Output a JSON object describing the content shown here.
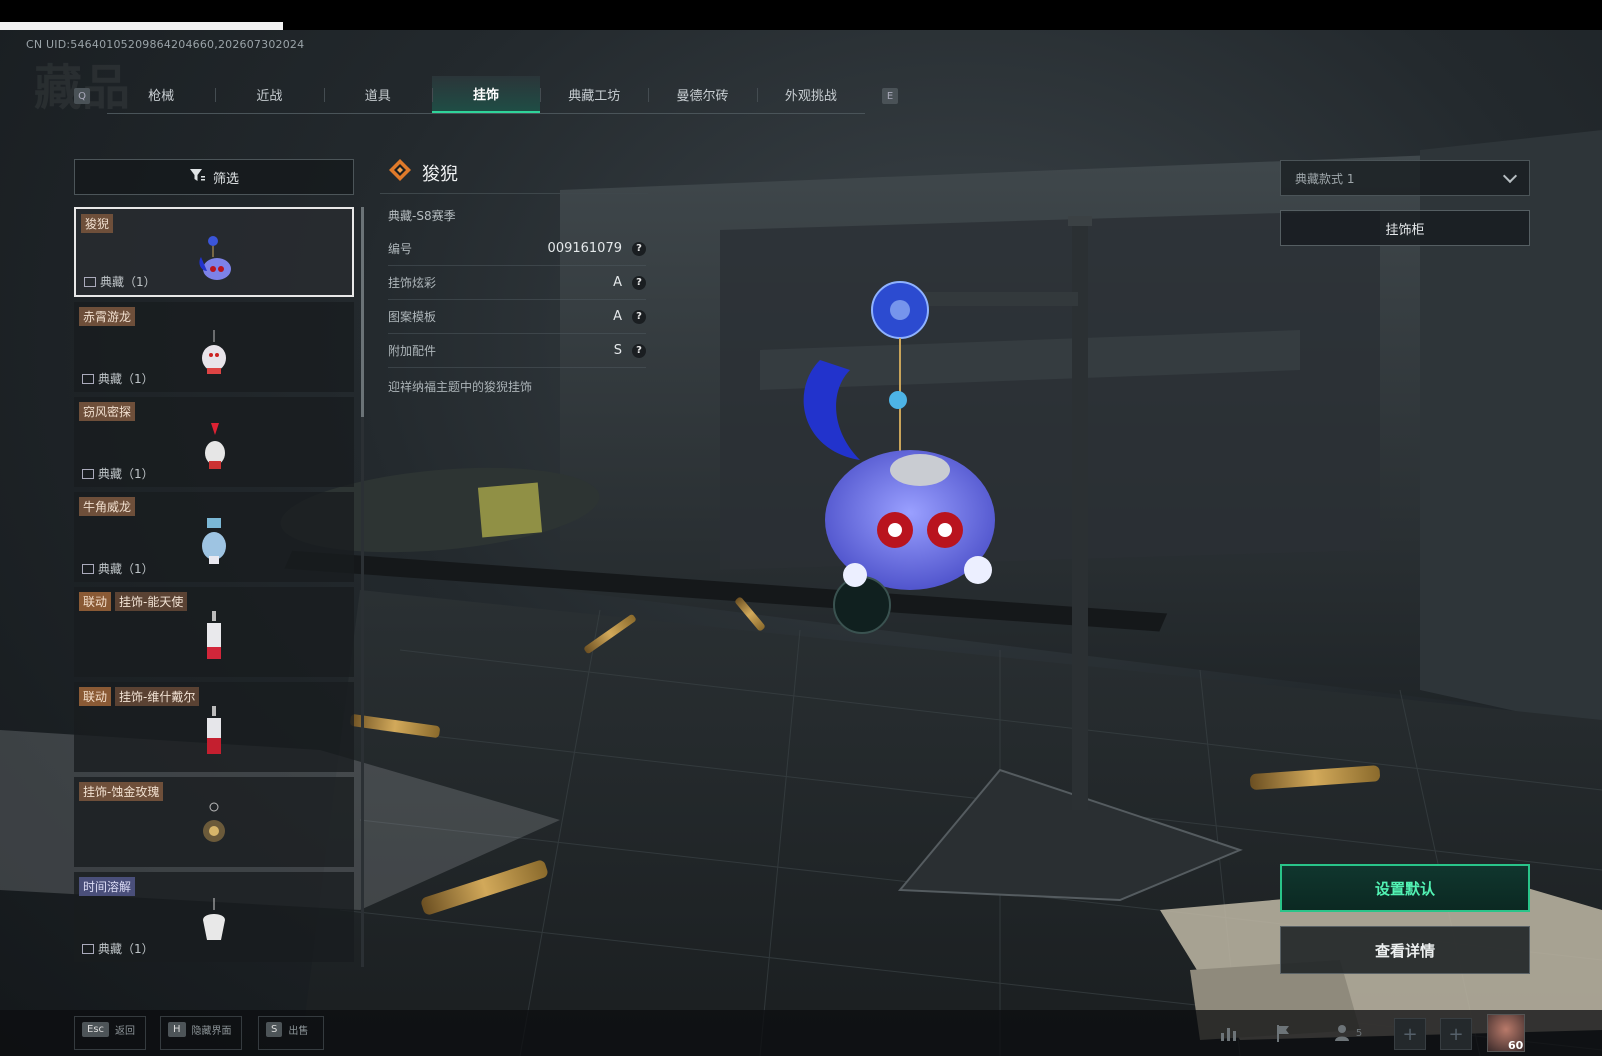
{
  "header": {
    "uid": "CN UID:54640105209864204660,202607302024",
    "ghost_title": "藏品",
    "left_key": "Q",
    "right_key": "E",
    "tabs": [
      {
        "label": "枪械",
        "active": false
      },
      {
        "label": "近战",
        "active": false
      },
      {
        "label": "道具",
        "active": false
      },
      {
        "label": "挂饰",
        "active": true
      },
      {
        "label": "典藏工坊",
        "active": false
      },
      {
        "label": "曼德尔砖",
        "active": false
      },
      {
        "label": "外观挑战",
        "active": false
      }
    ]
  },
  "filter": {
    "label": "筛选"
  },
  "items": [
    {
      "tag": "狻猊",
      "sub": "典藏（1）",
      "selected": true,
      "tag_style": "brown"
    },
    {
      "tag": "赤霄游龙",
      "sub": "典藏（1）",
      "selected": false,
      "tag_style": "brown"
    },
    {
      "tag": "窃风密探",
      "sub": "典藏（1）",
      "selected": false,
      "tag_style": "brown"
    },
    {
      "tag": "牛角威龙",
      "sub": "典藏（1）",
      "selected": false,
      "tag_style": "brown"
    },
    {
      "collab": "联动",
      "tag": "挂饰-能天使",
      "sub": "",
      "selected": false
    },
    {
      "collab": "联动",
      "tag": "挂饰-维什戴尔",
      "sub": "",
      "selected": false
    },
    {
      "tag": "挂饰-蚀金玫瑰",
      "sub": "",
      "selected": false,
      "tag_style": "brown"
    },
    {
      "tag": "时间溶解",
      "sub": "典藏（1）",
      "selected": false,
      "tag_style": "blue"
    }
  ],
  "detail": {
    "title": "狻猊",
    "season": "典藏-S8赛季",
    "rows": [
      {
        "label": "编号",
        "value": "009161079"
      },
      {
        "label": "挂饰炫彩",
        "value": "A"
      },
      {
        "label": "图案模板",
        "value": "A"
      },
      {
        "label": "附加配件",
        "value": "S"
      }
    ],
    "help": "?",
    "description": "迎祥纳福主题中的狻猊挂饰"
  },
  "right": {
    "style_select": "典藏款式 1",
    "cabinet_label": "挂饰柜",
    "default_label": "设置默认",
    "details_label": "查看详情"
  },
  "bottom": {
    "hints": [
      {
        "key": "Esc",
        "label": "返回"
      },
      {
        "key": "H",
        "label": "隐藏界面"
      },
      {
        "key": "S",
        "label": "出售"
      }
    ],
    "friends_count": "5",
    "level": "60"
  },
  "colors": {
    "accent_green": "#2fd49a",
    "tag_brown": "#6e4f3a",
    "tag_blue": "#4a4f7a"
  }
}
